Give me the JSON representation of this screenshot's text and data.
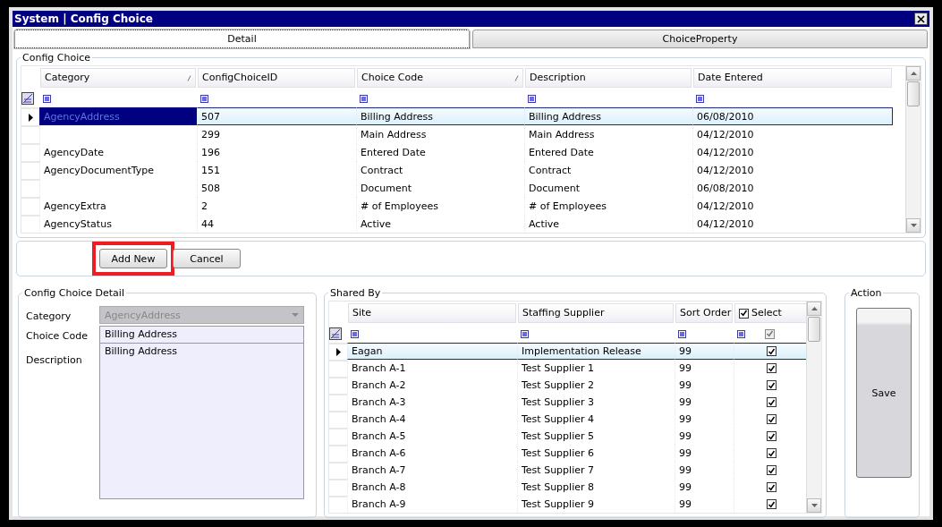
{
  "window": {
    "title": "System | Config Choice"
  },
  "tabs": [
    {
      "label": "Detail",
      "selected": true
    },
    {
      "label": "ChoiceProperty",
      "selected": false
    }
  ],
  "config_choice": {
    "legend": "Config Choice",
    "columns": [
      {
        "label": "Category",
        "sorted": true
      },
      {
        "label": "ConfigChoiceID",
        "sorted": false
      },
      {
        "label": "Choice Code",
        "sorted": true
      },
      {
        "label": "Description",
        "sorted": false
      },
      {
        "label": "Date Entered",
        "sorted": false
      }
    ],
    "rows": [
      {
        "category": "AgencyAddress",
        "id": "507",
        "code": "Billing Address",
        "description": "Billing Address",
        "date": "06/08/2010",
        "selected": true
      },
      {
        "id": "299",
        "code": "Main Address",
        "description": "Main Address",
        "date": "04/12/2010",
        "selected": false
      },
      {
        "category": "AgencyDate",
        "id": "196",
        "code": "Entered Date",
        "description": "Entered Date",
        "date": "04/12/2010",
        "selected": false
      },
      {
        "category": "AgencyDocumentType",
        "id": "151",
        "code": "Contract",
        "description": "Contract",
        "date": "04/12/2010",
        "selected": false
      },
      {
        "id": "508",
        "code": "Document",
        "description": "Document",
        "date": "06/08/2010",
        "selected": false
      },
      {
        "category": "AgencyExtra",
        "id": "2",
        "code": "# of Employees",
        "description": "# of Employees",
        "date": "04/12/2010",
        "selected": false
      },
      {
        "category": "AgencyStatus",
        "id": "44",
        "code": "Active",
        "description": "Active",
        "date": "04/12/2010",
        "selected": false
      }
    ]
  },
  "buttons": [
    {
      "label": "Add New",
      "highlighted": true
    },
    {
      "label": "Cancel",
      "highlighted": false
    }
  ],
  "detail": {
    "legend": "Config Choice  Detail",
    "fields": [
      {
        "kind": "dropdown",
        "label": "Category",
        "value": "AgencyAddress",
        "disabled": true
      },
      {
        "kind": "text",
        "label": "Choice Code",
        "value": "Billing Address",
        "disabled": false
      },
      {
        "kind": "textarea",
        "label": "Description",
        "value": "Billing Address",
        "disabled": false
      }
    ]
  },
  "shared_by": {
    "legend": "Shared By",
    "columns": [
      {
        "label": "Site"
      },
      {
        "label": "Staffing Supplier"
      },
      {
        "label": "Sort Order"
      },
      {
        "label": "Select",
        "checked": true
      }
    ],
    "filter_checked": true,
    "rows": [
      {
        "site": "Eagan",
        "supplier": "Implementation Release",
        "sort_order": "99",
        "checked": true,
        "selected": true
      },
      {
        "site": "Branch A-1",
        "supplier": "Test Supplier 1",
        "sort_order": "99",
        "checked": true,
        "selected": false
      },
      {
        "site": "Branch A-2",
        "supplier": "Test Supplier 2",
        "sort_order": "99",
        "checked": true,
        "selected": false
      },
      {
        "site": "Branch A-3",
        "supplier": "Test Supplier 3",
        "sort_order": "99",
        "checked": true,
        "selected": false
      },
      {
        "site": "Branch A-4",
        "supplier": "Test Supplier 4",
        "sort_order": "99",
        "checked": true,
        "selected": false
      },
      {
        "site": "Branch A-5",
        "supplier": "Test Supplier 5",
        "sort_order": "99",
        "checked": true,
        "selected": false
      },
      {
        "site": "Branch A-6",
        "supplier": "Test Supplier 6",
        "sort_order": "99",
        "checked": true,
        "selected": false
      },
      {
        "site": "Branch A-7",
        "supplier": "Test Supplier 7",
        "sort_order": "99",
        "checked": true,
        "selected": false
      },
      {
        "site": "Branch A-8",
        "supplier": "Test Supplier 8",
        "sort_order": "99",
        "checked": true,
        "selected": false
      },
      {
        "site": "Branch A-9",
        "supplier": "Test Supplier 9",
        "sort_order": "99",
        "checked": true,
        "selected": false
      }
    ]
  },
  "action": {
    "legend": "Action",
    "button": "Save"
  }
}
